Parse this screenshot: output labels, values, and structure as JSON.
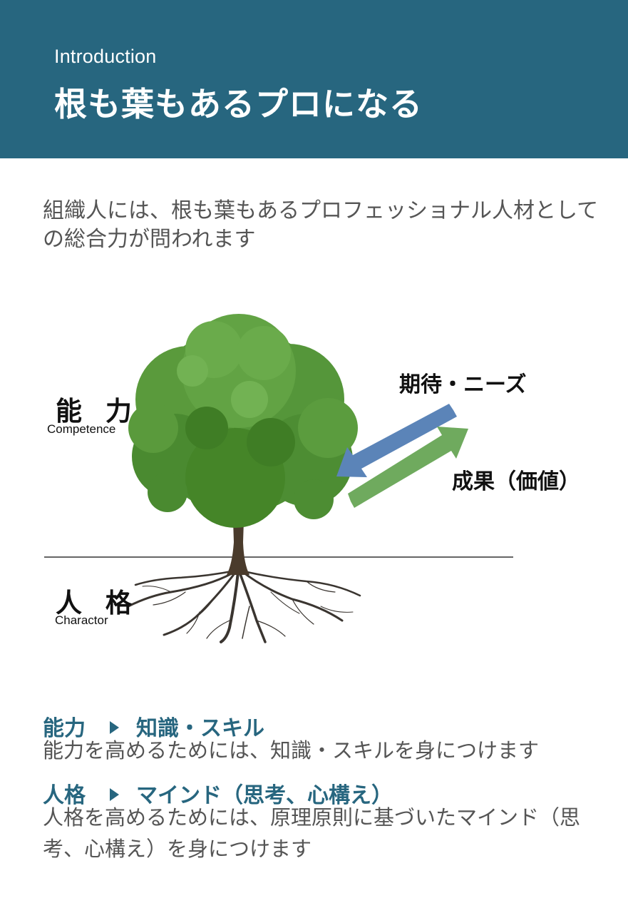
{
  "header": {
    "eyebrow": "Introduction",
    "title": "根も葉もあるプロになる"
  },
  "lead_text": "組織人には、根も葉もあるプロフェッショナル人材としての総合力が問われます",
  "diagram": {
    "competence_jp": "能 力",
    "competence_en": "Competence",
    "character_jp": "人 格",
    "character_en": "Charactor",
    "expectation_label": "期待・ニーズ",
    "result_label": "成果（価値）",
    "colors": {
      "expectation_arrow": "#5b84b8",
      "result_arrow": "#6faa5e",
      "foliage": "#4f8f34",
      "trunk": "#4a3b2c"
    }
  },
  "sections": [
    {
      "head_left": "能力",
      "head_right": "知識・スキル",
      "body": "能力を高めるためには、知識・スキルを身につけます"
    },
    {
      "head_left": "人格",
      "head_right": "マインド（思考、心構え）",
      "body": "人格を高めるためには、原理原則に基づいたマインド（思考、心構え）を身につけます"
    }
  ],
  "colors": {
    "header_bg": "#27667f",
    "accent": "#27667f",
    "body_text": "#555555"
  }
}
